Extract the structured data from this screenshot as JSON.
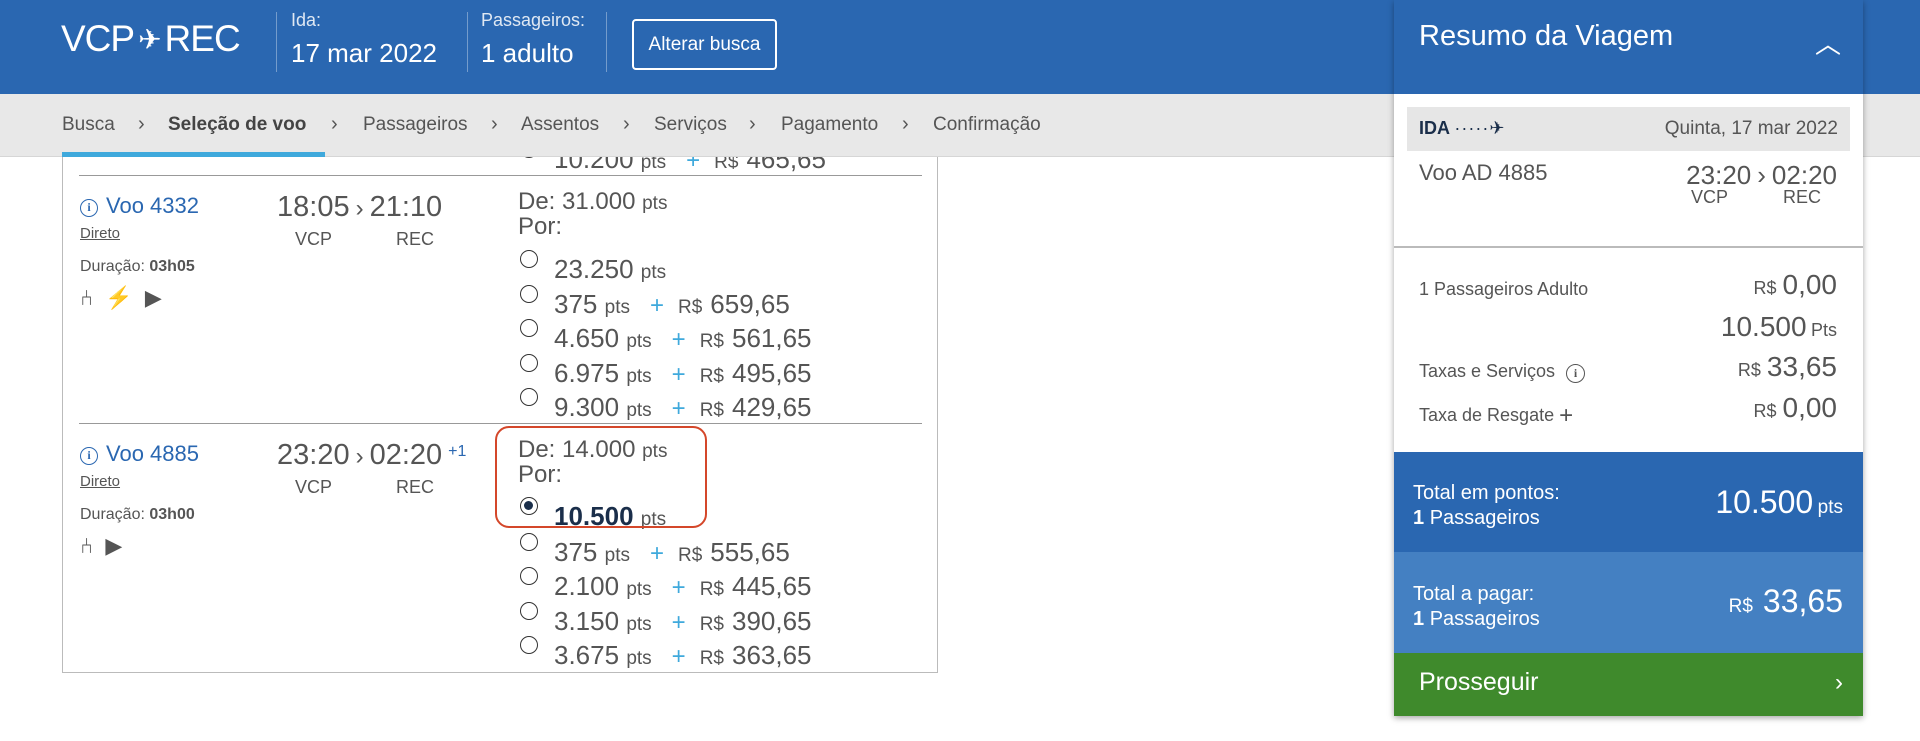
{
  "header": {
    "origin": "VCP",
    "destination": "REC",
    "route_icon": "airplane-icon",
    "ida_label": "Ida:",
    "ida_date": "17  mar  2022",
    "passengers_label": "Passageiros:",
    "passengers_value": "1 adulto",
    "alter_button": "Alterar busca"
  },
  "breadcrumb": {
    "steps": [
      "Busca",
      "Seleção de voo",
      "Passageiros",
      "Assentos",
      "Serviços",
      "Pagamento",
      "Confirmação"
    ],
    "active_index": 1
  },
  "flights": {
    "partial_top": {
      "points": "10.200",
      "unit": "pts",
      "currency": "R$",
      "price": "465,65"
    },
    "f1": {
      "name": "Voo 4332",
      "type": "Direto",
      "duration_label": "Duração:",
      "duration": "03h05",
      "depart": "18:05",
      "arrive": "21:10",
      "depart_ap": "VCP",
      "arrive_ap": "REC",
      "de_label": "De:",
      "de_points": "31.000",
      "por_label": "Por:",
      "unit": "pts",
      "currency": "R$",
      "amenities": [
        "seat-icon",
        "power-plug-icon",
        "play-icon"
      ],
      "options": [
        {
          "points": "23.250",
          "price": ""
        },
        {
          "points": "375",
          "price": "659,65"
        },
        {
          "points": "4.650",
          "price": "561,65"
        },
        {
          "points": "6.975",
          "price": "495,65"
        },
        {
          "points": "9.300",
          "price": "429,65"
        }
      ]
    },
    "f2": {
      "name": "Voo 4885",
      "type": "Direto",
      "duration_label": "Duração:",
      "duration": "03h00",
      "depart": "23:20",
      "arrive": "02:20",
      "next_day": "+1",
      "depart_ap": "VCP",
      "arrive_ap": "REC",
      "de_label": "De:",
      "de_points": "14.000",
      "por_label": "Por:",
      "unit": "pts",
      "currency": "R$",
      "amenities": [
        "seat-icon",
        "play-icon"
      ],
      "selected_index": 0,
      "options": [
        {
          "points": "10.500",
          "price": ""
        },
        {
          "points": "375",
          "price": "555,65"
        },
        {
          "points": "2.100",
          "price": "445,65"
        },
        {
          "points": "3.150",
          "price": "390,65"
        },
        {
          "points": "3.675",
          "price": "363,65"
        }
      ]
    }
  },
  "summary": {
    "title": "Resumo da Viagem",
    "ida_label": "IDA",
    "ida_date": "Quinta, 17  mar 2022",
    "flight_label": "Voo  AD 4885",
    "depart": "23:20",
    "arrive": "02:20",
    "depart_ap": "VCP",
    "arrive_ap": "REC",
    "pax_label": "1 Passageiros Adulto",
    "currency": "R$",
    "pax_price": "0,00",
    "pax_points": "10.500",
    "pax_points_unit": "Pts",
    "taxes_label": "Taxas e Serviços",
    "taxes_value": "33,65",
    "redeem_label": "Taxa de Resgate",
    "redeem_value": "0,00",
    "total_points_label": "Total em pontos:",
    "total_points_pax_count": "1",
    "total_points_pax_label": "Passageiros",
    "total_points_value": "10.500",
    "total_points_unit": "pts",
    "total_pay_label": "Total a pagar:",
    "total_pay_pax_count": "1",
    "total_pay_pax_label": "Passageiros",
    "total_pay_value": "33,65",
    "proceed_label": "Prosseguir"
  },
  "colors": {
    "brand_blue": "#2a67b1",
    "accent_cyan": "#3fa9dc",
    "total_points_bg": "#2a67b1",
    "total_pay_bg": "#4480c2",
    "proceed_green": "#3f8a2c",
    "highlight_red": "#d4472a"
  }
}
